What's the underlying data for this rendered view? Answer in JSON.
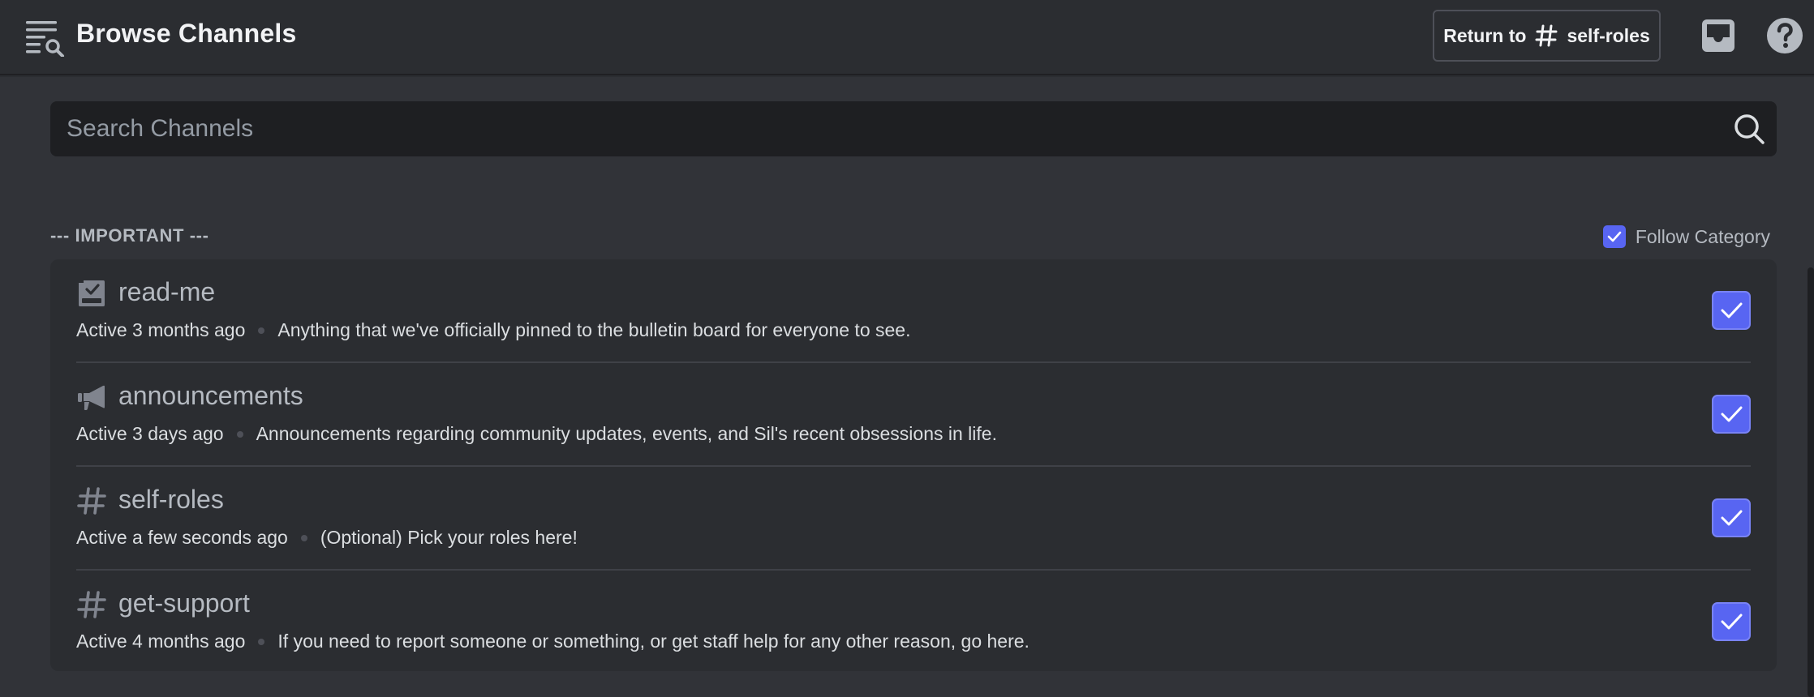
{
  "header": {
    "title": "Browse Channels",
    "return_prefix": "Return to",
    "return_channel": "self-roles",
    "icons": [
      "browse-channels-icon",
      "hash-icon",
      "inbox-icon",
      "help-icon"
    ]
  },
  "search": {
    "placeholder": "Search Channels",
    "value": "",
    "icon": "search-icon"
  },
  "category": {
    "name": "--- IMPORTANT ---",
    "follow_label": "Follow Category",
    "following": true
  },
  "channels": [
    {
      "name": "read-me",
      "icon": "rules-icon",
      "activity": "Active 3 months ago",
      "description": "Anything that we've officially pinned to the bulletin board for everyone to see.",
      "followed": true
    },
    {
      "name": "announcements",
      "icon": "megaphone-icon",
      "activity": "Active 3 days ago",
      "description": "Announcements regarding community updates, events, and Sil's recent obsessions in life.",
      "followed": true
    },
    {
      "name": "self-roles",
      "icon": "hash-icon",
      "activity": "Active a few seconds ago",
      "description": "(Optional) Pick your roles here!",
      "followed": true
    },
    {
      "name": "get-support",
      "icon": "hash-icon",
      "activity": "Active 4 months ago",
      "description": "If you need to report someone or something, or get staff help for any other reason, go here.",
      "followed": true
    }
  ],
  "colors": {
    "accent": "#5865f2",
    "background": "#313338",
    "card": "#2b2d31",
    "input": "#1e1f22"
  }
}
